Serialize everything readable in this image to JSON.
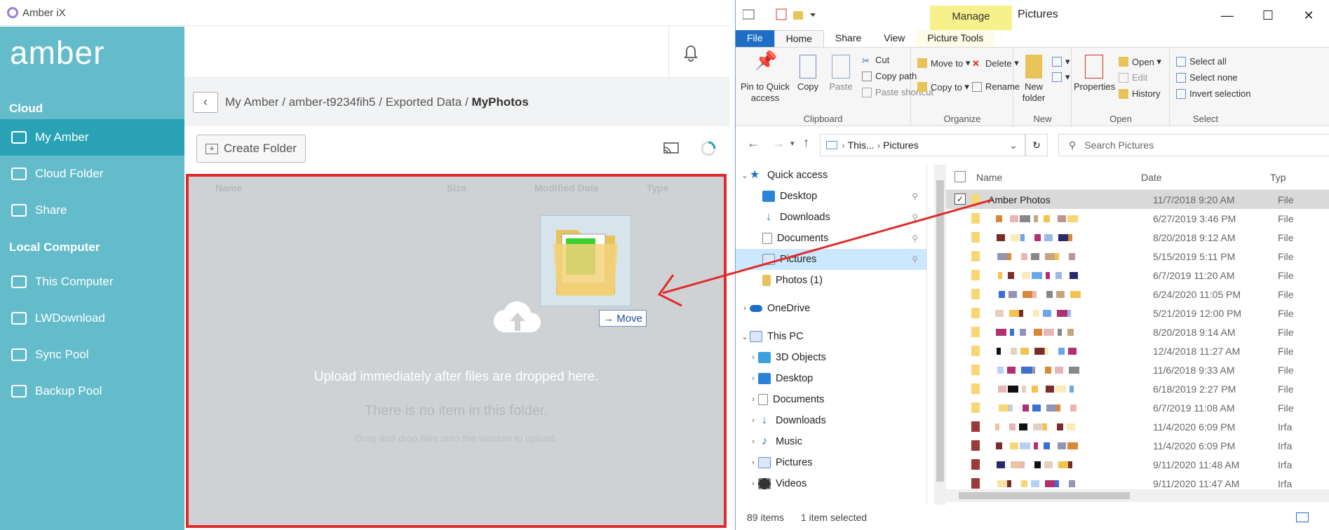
{
  "amber": {
    "window_title": "Amber iX",
    "brand": "amber",
    "sections": [
      "Cloud",
      "Local Computer"
    ],
    "cloud_items": [
      {
        "label": "My Amber",
        "active": true
      },
      {
        "label": "Cloud Folder"
      },
      {
        "label": "Share"
      }
    ],
    "local_items": [
      {
        "label": "This Computer"
      },
      {
        "label": "LWDownload"
      },
      {
        "label": "Sync Pool"
      },
      {
        "label": "Backup Pool"
      }
    ],
    "breadcrumb": [
      "My Amber",
      "amber-t9234fih5",
      "Exported Data",
      "MyPhotos"
    ],
    "create_folder": "Create Folder",
    "column_headers": [
      "Name",
      "Size",
      "Modified Date",
      "Type"
    ],
    "upload_text": "Upload immediately after files are dropped here.",
    "empty_text": "There is no item in this folder.",
    "empty_sub": "Drag and drop files onto the window to upload.",
    "drag_badge": "Move"
  },
  "explorer": {
    "manage_tab": "Manage",
    "title": "Pictures",
    "tabs": [
      "File",
      "Home",
      "Share",
      "View",
      "Picture Tools"
    ],
    "clipboard": {
      "pin": "Pin to Quick access",
      "copy": "Copy",
      "paste": "Paste",
      "cut": "Cut",
      "copy_path": "Copy path",
      "paste_shortcut": "Paste shortcut",
      "label": "Clipboard"
    },
    "organize": {
      "move_to": "Move to",
      "copy_to": "Copy to",
      "delete": "Delete",
      "rename": "Rename",
      "label": "Organize"
    },
    "new": {
      "new_folder": "New folder",
      "label": "New"
    },
    "open": {
      "properties": "Properties",
      "open": "Open",
      "edit": "Edit",
      "history": "History",
      "label": "Open"
    },
    "select": {
      "select_all": "Select all",
      "select_none": "Select none",
      "invert": "Invert selection",
      "label": "Select"
    },
    "address": [
      "This...",
      "Pictures"
    ],
    "search_placeholder": "Search Pictures",
    "nav": {
      "quick_access": "Quick access",
      "qa_items": [
        "Desktop",
        "Downloads",
        "Documents",
        "Pictures",
        "Photos (1)"
      ],
      "onedrive": "OneDrive",
      "this_pc": "This PC",
      "pc_items": [
        "3D Objects",
        "Desktop",
        "Documents",
        "Downloads",
        "Music",
        "Pictures",
        "Videos"
      ]
    },
    "columns": [
      "Name",
      "Date",
      "Typ"
    ],
    "rows": [
      {
        "name": "Amber Photos",
        "date": "11/7/2018 9:20 AM",
        "type": "File"
      },
      {
        "name": "",
        "date": "6/27/2019 3:46 PM",
        "type": "File"
      },
      {
        "name": "",
        "date": "8/20/2018 9:12 AM",
        "type": "File"
      },
      {
        "name": "",
        "date": "5/15/2019 5:11 PM",
        "type": "File"
      },
      {
        "name": "",
        "date": "6/7/2019 11:20 AM",
        "type": "File"
      },
      {
        "name": "",
        "date": "6/24/2020 11:05 PM",
        "type": "File"
      },
      {
        "name": "",
        "date": "5/21/2019 12:00 PM",
        "type": "File"
      },
      {
        "name": "",
        "date": "8/20/2018 9:14 AM",
        "type": "File"
      },
      {
        "name": "",
        "date": "12/4/2018 11:27 AM",
        "type": "File"
      },
      {
        "name": "",
        "date": "11/6/2018 9:33 AM",
        "type": "File"
      },
      {
        "name": "",
        "date": "6/18/2019 2:27 PM",
        "type": "File"
      },
      {
        "name": "",
        "date": "6/7/2019 11:08 AM",
        "type": "File"
      },
      {
        "name": "",
        "date": "11/4/2020 6:09 PM",
        "type": "Irfa"
      },
      {
        "name": "",
        "date": "11/4/2020 6:09 PM",
        "type": "Irfa"
      },
      {
        "name": "",
        "date": "9/11/2020 11:48 AM",
        "type": "Irfa"
      },
      {
        "name": "",
        "date": "9/11/2020 11:47 AM",
        "type": "Irfa"
      }
    ],
    "status_count": "89 items",
    "status_selected": "1 item selected"
  },
  "colors": {
    "sidebar": "#64bccb",
    "sidebar_active": "#2aa2b6",
    "dropzone_border": "#e02b2b",
    "file_tab": "#1e6ec5",
    "manage_tab": "#f6f18a",
    "nav_selected": "#cce8ff"
  }
}
